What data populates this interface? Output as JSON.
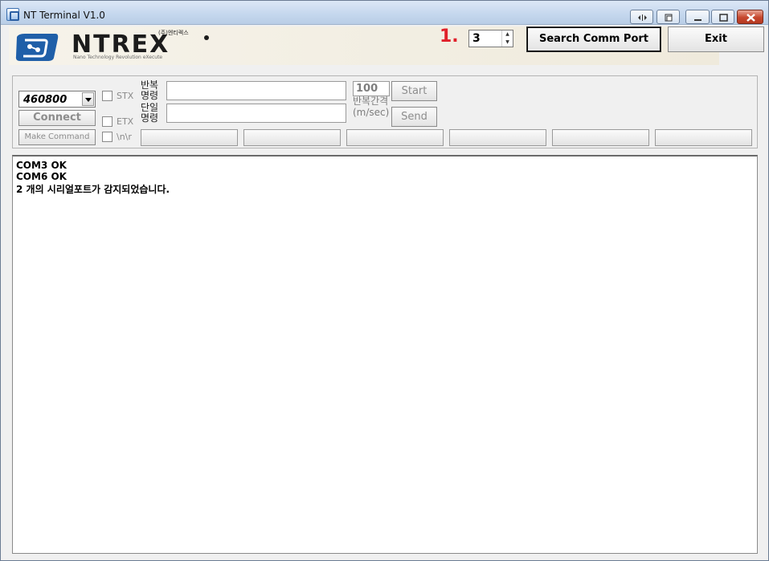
{
  "window": {
    "title": "NT Terminal V1.0"
  },
  "logo": {
    "wordmark": "NTREX",
    "corp_name": "(주)엔티렉스",
    "tagline": "Nano Technology Revolution eXecute"
  },
  "header": {
    "step_annotation": "1.",
    "port_count_value": "3",
    "search_button_label": "Search Comm Port",
    "exit_button_label": "Exit"
  },
  "controls": {
    "baud_rate": "460800",
    "connect_label": "Connect",
    "make_command_label": "Make Command",
    "stx_label": "STX",
    "etx_label": "ETX",
    "newline_label": "\\n\\r",
    "repeat_cmd_label": "반복 명령",
    "repeat_cmd_value": "",
    "single_cmd_label": "단일 명령",
    "single_cmd_value": "",
    "interval_value": "100",
    "interval_label_line1": "반복간격",
    "interval_label_line2": "(m/sec)",
    "start_label": "Start",
    "send_label": "Send",
    "command_buttons": [
      "",
      "",
      "",
      "",
      "",
      ""
    ]
  },
  "console": {
    "lines": [
      "COM3 OK",
      "COM6 OK",
      "2 개의 시리얼포트가 감지되었습니다."
    ]
  },
  "colors": {
    "step_annotation": "#e0202a",
    "title_bar": "#c6d8ee",
    "logo_blue": "#1f5fa8"
  }
}
